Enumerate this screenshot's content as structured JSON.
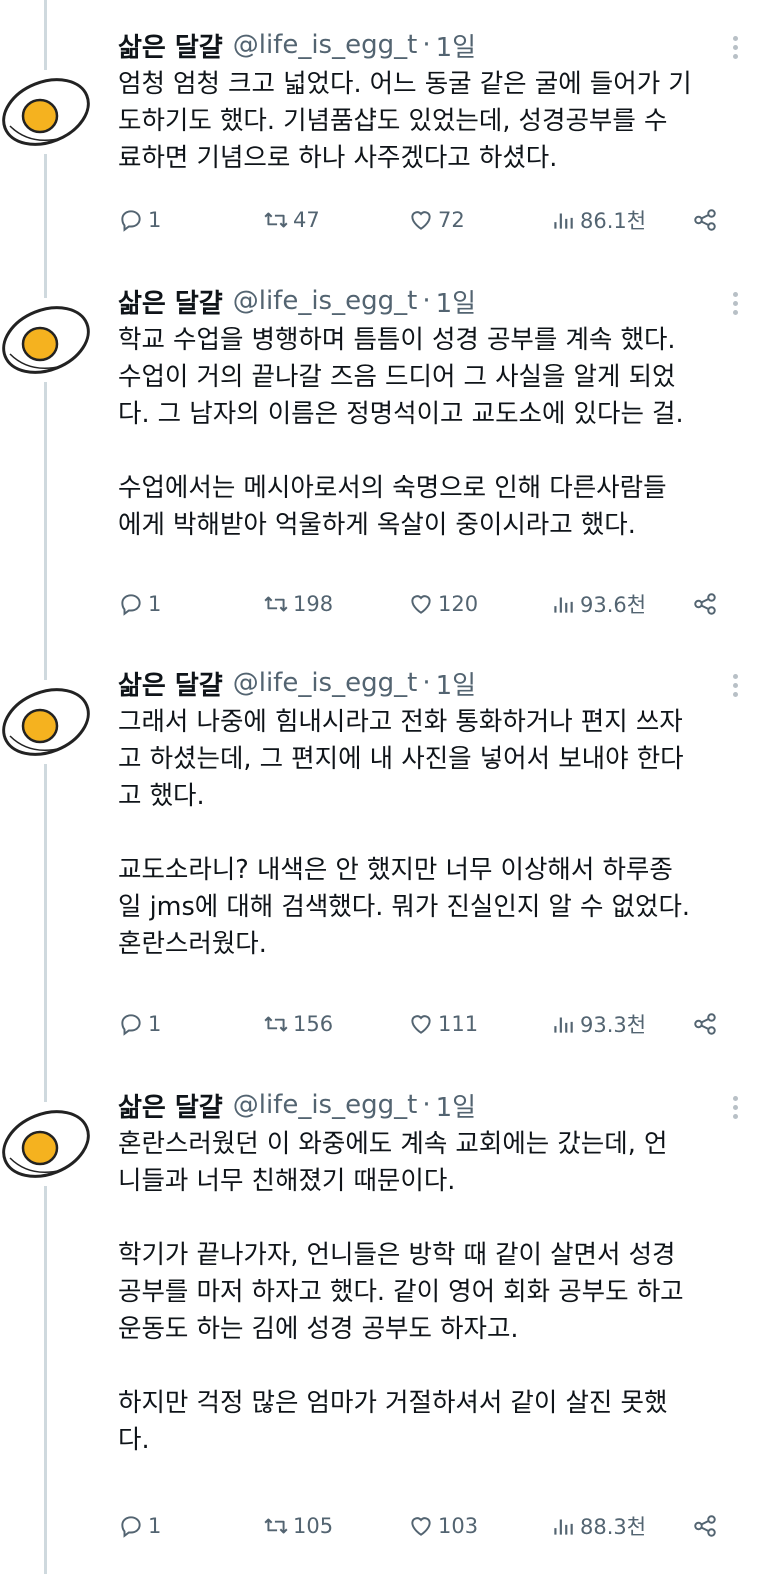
{
  "user": {
    "name": "삶은 달걀",
    "handle": "@life_is_egg_t",
    "separator": "·"
  },
  "tweets": [
    {
      "time": "1일",
      "paragraphs": [
        [
          "엄청 엄청 크고 넓었다. 어느 동굴 같은 굴에 들어가 기",
          "도하기도 했다. 기념품샵도 있었는데, 성경공부를 수",
          "료하면 기념으로 하나 사주겠다고 하셨다."
        ]
      ],
      "stats": {
        "replies": "1",
        "retweets": "47",
        "likes": "72",
        "views": "86.1천"
      }
    },
    {
      "time": "1일",
      "paragraphs": [
        [
          "학교 수업을 병행하며 틈틈이 성경 공부를 계속 했다.",
          "수업이 거의 끝나갈 즈음 드디어 그 사실을 알게 되었",
          "다. 그 남자의 이름은 정명석이고 교도소에 있다는 걸."
        ],
        [
          "수업에서는 메시아로서의 숙명으로 인해 다른사람들",
          "에게 박해받아 억울하게 옥살이 중이시라고 했다."
        ]
      ],
      "stats": {
        "replies": "1",
        "retweets": "198",
        "likes": "120",
        "views": "93.6천"
      }
    },
    {
      "time": "1일",
      "paragraphs": [
        [
          "그래서 나중에 힘내시라고 전화 통화하거나 편지 쓰자",
          "고 하셨는데, 그 편지에 내 사진을 넣어서 보내야 한다",
          "고 했다."
        ],
        [
          "교도소라니? 내색은 안 했지만 너무 이상해서 하루종",
          "일 jms에 대해 검색했다. 뭐가 진실인지 알 수 없었다.",
          "혼란스러웠다."
        ]
      ],
      "stats": {
        "replies": "1",
        "retweets": "156",
        "likes": "111",
        "views": "93.3천"
      }
    },
    {
      "time": "1일",
      "paragraphs": [
        [
          "혼란스러웠던 이 와중에도 계속 교회에는 갔는데, 언",
          "니들과 너무 친해졌기 때문이다."
        ],
        [
          "학기가 끝나가자, 언니들은 방학 때 같이 살면서 성경",
          "공부를 마저 하자고 했다. 같이 영어 회화 공부도 하고",
          "운동도 하는 김에 성경 공부도 하자고."
        ],
        [
          "하지만 걱정 많은 엄마가 거절하셔서 같이 살진 못했",
          "다."
        ]
      ],
      "stats": {
        "replies": "1",
        "retweets": "105",
        "likes": "103",
        "views": "88.3천"
      }
    }
  ],
  "icons": {
    "avatar": "boiled-egg-icon",
    "reply": "reply-icon",
    "retweet": "retweet-icon",
    "like": "heart-icon",
    "views": "views-icon",
    "share": "share-icon",
    "more": "more-icon"
  },
  "colors": {
    "text": "#0f1419",
    "secondary": "#536471",
    "thread_line": "#cfd9de",
    "egg_yolk": "#f5b21f",
    "egg_white": "#ffffff"
  }
}
